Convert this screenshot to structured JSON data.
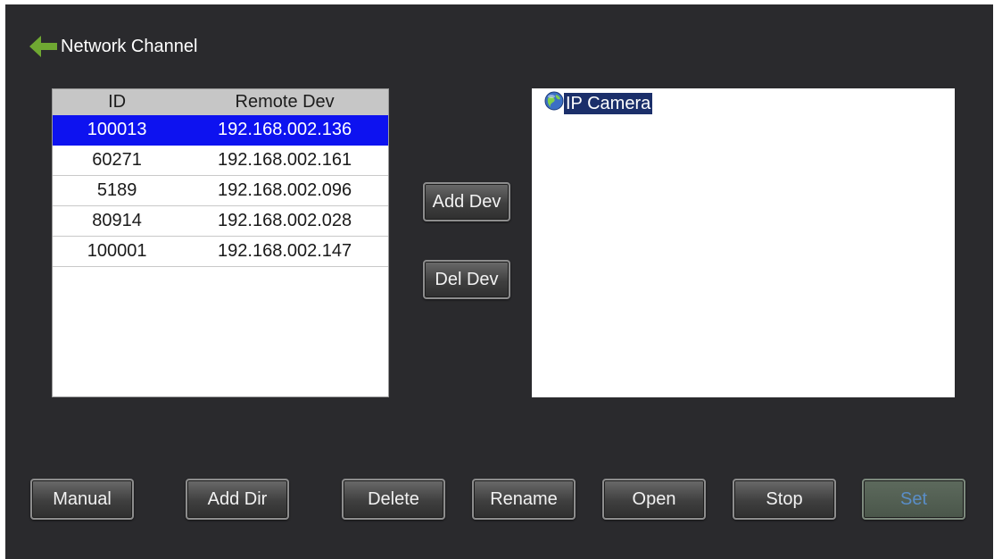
{
  "header": {
    "back_icon": "back-arrow-icon",
    "back_icon_color": "#6fa832",
    "title": "Network Channel"
  },
  "device_table": {
    "columns": [
      "ID",
      "Remote Dev"
    ],
    "rows": [
      {
        "id": "100013",
        "remote_dev": "192.168.002.136",
        "selected": true
      },
      {
        "id": "60271",
        "remote_dev": "192.168.002.161",
        "selected": false
      },
      {
        "id": "5189",
        "remote_dev": "192.168.002.096",
        "selected": false
      },
      {
        "id": "80914",
        "remote_dev": "192.168.002.028",
        "selected": false
      },
      {
        "id": "100001",
        "remote_dev": "192.168.002.147",
        "selected": false
      }
    ],
    "selected_color": "#0d12f0"
  },
  "middle_buttons": {
    "add_dev": "Add Dev",
    "del_dev": "Del Dev"
  },
  "tree": {
    "root_icon": "globe-icon",
    "root_label": "IP Camera"
  },
  "toolbar": {
    "manual": "Manual",
    "add_dir": "Add Dir",
    "delete": "Delete",
    "rename": "Rename",
    "open": "Open",
    "stop": "Stop",
    "set": "Set"
  }
}
